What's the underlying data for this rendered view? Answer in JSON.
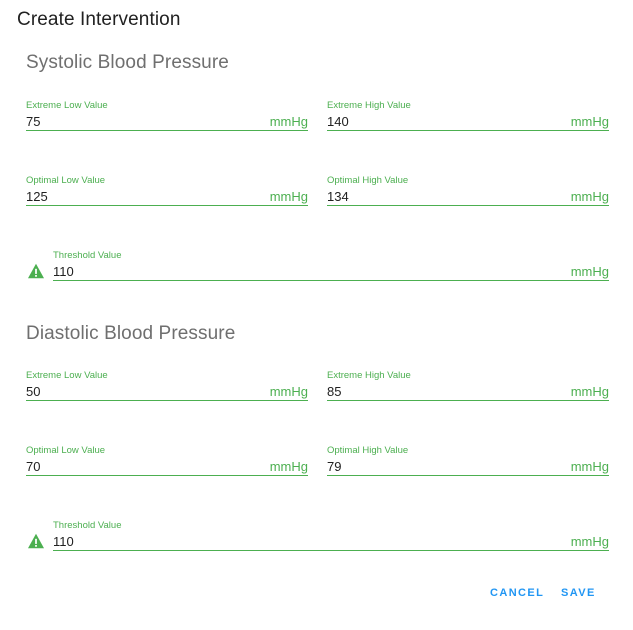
{
  "dialog": {
    "title": "Create Intervention",
    "cancel_label": "CANCEL",
    "save_label": "SAVE"
  },
  "systolic": {
    "title": "Systolic Blood Pressure",
    "extreme_low": {
      "label": "Extreme Low Value",
      "value": "75",
      "unit": "mmHg"
    },
    "extreme_high": {
      "label": "Extreme High Value",
      "value": "140",
      "unit": "mmHg"
    },
    "optimal_low": {
      "label": "Optimal Low Value",
      "value": "125",
      "unit": "mmHg"
    },
    "optimal_high": {
      "label": "Optimal High Value",
      "value": "134",
      "unit": "mmHg"
    },
    "threshold": {
      "label": "Threshold Value",
      "value": "110",
      "unit": "mmHg",
      "icon": "warning-icon"
    }
  },
  "diastolic": {
    "title": "Diastolic Blood Pressure",
    "extreme_low": {
      "label": "Extreme Low Value",
      "value": "50",
      "unit": "mmHg"
    },
    "extreme_high": {
      "label": "Extreme High Value",
      "value": "85",
      "unit": "mmHg"
    },
    "optimal_low": {
      "label": "Optimal Low Value",
      "value": "70",
      "unit": "mmHg"
    },
    "optimal_high": {
      "label": "Optimal High Value",
      "value": "79",
      "unit": "mmHg"
    },
    "threshold": {
      "label": "Threshold Value",
      "value": "110",
      "unit": "mmHg",
      "icon": "warning-icon"
    }
  },
  "colors": {
    "accent_green": "#4caf50",
    "action_blue": "#2196f3",
    "section_title_gray": "#6f6f6f"
  }
}
